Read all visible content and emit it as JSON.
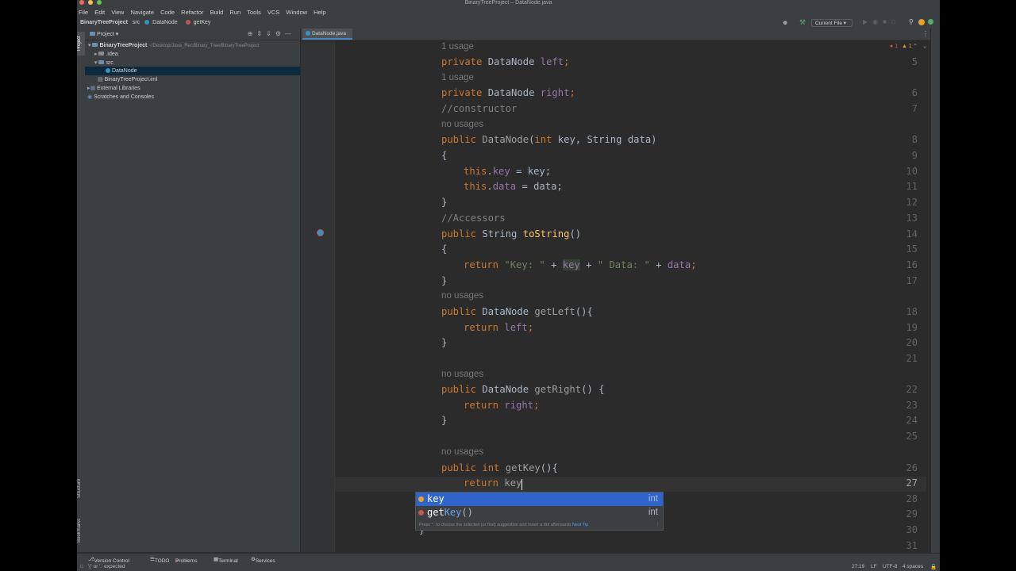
{
  "window": {
    "title": "BinaryTreeProject – DataNode.java"
  },
  "menu": [
    "File",
    "Edit",
    "View",
    "Navigate",
    "Code",
    "Refactor",
    "Build",
    "Run",
    "Tools",
    "VCS",
    "Window",
    "Help"
  ],
  "breadcrumb": [
    "BinaryTreeProject",
    "src",
    "DataNode",
    "getKey"
  ],
  "run_config": "Current File",
  "left_tabs": {
    "project": "Project",
    "structure": "Structure",
    "bookmarks": "Bookmarks"
  },
  "project_panel": {
    "title": "Project",
    "tree": [
      {
        "label": "BinaryTreeProject",
        "detail": "~/Desktop/Java_Rec/Binary_Tree/BinaryTreeProject"
      },
      {
        "label": ".idea"
      },
      {
        "label": "src"
      },
      {
        "label": "DataNode"
      },
      {
        "label": "BinaryTreeProject.iml"
      },
      {
        "label": "External Libraries"
      },
      {
        "label": "Scratches and Consoles"
      }
    ]
  },
  "tabs": [
    {
      "label": "DataNode.java"
    }
  ],
  "editor": {
    "inspection": {
      "errors": "1",
      "warnings": "1"
    },
    "hints": {
      "h1": "1 usage",
      "h2": "1 usage",
      "h3": "no usages",
      "h4": "no usages",
      "h5": "no usages",
      "h6": "no usages"
    },
    "line_numbers": [
      "5",
      "6",
      "7",
      "8",
      "9",
      "10",
      "11",
      "12",
      "13",
      "14",
      "15",
      "16",
      "17",
      "18",
      "19",
      "20",
      "21",
      "22",
      "23",
      "24",
      "25",
      "26",
      "27",
      "28",
      "29",
      "30",
      "31"
    ],
    "code": {
      "l5": {
        "kw": "private",
        "type": " DataNode ",
        "fld": "left",
        "end": ";"
      },
      "l6": {
        "kw": "private",
        "type": " DataNode ",
        "fld": "right",
        "end": ";"
      },
      "l7": "//constructor",
      "l8": {
        "kw1": "public",
        "name": " DataNode",
        "p1": "(",
        "kw2": "int",
        "p2": " key, String data)"
      },
      "l9": "{",
      "l10": {
        "kw": "this",
        "dot": ".",
        "fld": "key",
        "rest": " = key;"
      },
      "l11": {
        "kw": "this",
        "dot": ".",
        "fld": "data",
        "rest": " = data;"
      },
      "l12": "}",
      "l13": "//Accessors",
      "l14": {
        "kw": "public",
        "type": " String ",
        "fn": "toString",
        "rest": "()"
      },
      "l15": "{",
      "l16": {
        "kw": "return",
        "s1": " \"Key: \"",
        "p1": " + ",
        "fld1": "key",
        "p2": " + ",
        "s2": "\" Data: \"",
        "p3": " + ",
        "fld2": "data",
        "end": ";"
      },
      "l17": "}",
      "l18": {
        "kw": "public",
        "type": " DataNode ",
        "fn": "getLeft",
        "rest": "(){"
      },
      "l19": {
        "kw": "return",
        "fld": " left",
        "end": ";"
      },
      "l20": "}",
      "l22": {
        "kw": "public",
        "type": " DataNode ",
        "fn": "getRight",
        "rest": "() {"
      },
      "l23": {
        "kw": "return",
        "fld": " right",
        "end": ";"
      },
      "l24": "}",
      "l26": {
        "kw1": "public",
        "sp": " ",
        "kw2": "int",
        "fn": " getKey",
        "rest": "(){"
      },
      "l27": {
        "kw": "return",
        "typed": " key"
      },
      "l28": "}",
      "l30": "}"
    }
  },
  "completion": {
    "items": [
      {
        "match": "key",
        "rest": "",
        "type": "int"
      },
      {
        "match": "get",
        "match2": "Key",
        "rest": "()",
        "type": "int"
      }
    ],
    "footer": "Press ^. to choose the selected (or first) suggestion and insert a dot afterwards",
    "footer_link": "Next Tip"
  },
  "toolwindows": [
    "Version Control",
    "TODO",
    "Problems",
    "Terminal",
    "Services"
  ],
  "status": {
    "message": "'(' or '.' expected",
    "position": "27:19",
    "line_sep": "LF",
    "encoding": "UTF-8",
    "indent": "4 spaces"
  },
  "colors": {
    "keyword": "#cc7832",
    "field": "#9876aa",
    "method": "#ffc66d",
    "string": "#6a8759",
    "selection": "#2f65ca"
  }
}
